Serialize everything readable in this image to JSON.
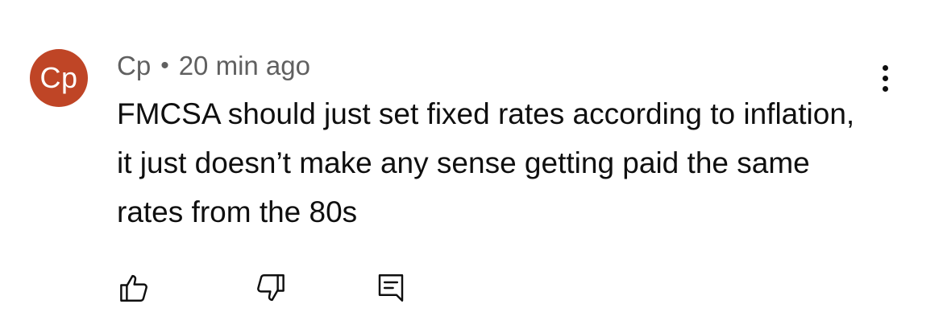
{
  "comment": {
    "avatar_initials": "Cp",
    "avatar_color": "#bf4526",
    "author": "Cp",
    "separator": "•",
    "timestamp": "20 min ago",
    "text": "FMCSA should just set fixed rates according to inflation, it just doesn’t make any sense getting paid the same rates from the 80s"
  },
  "actions": {
    "more_icon": "more-vertical-icon",
    "like_icon": "thumbs-up-icon",
    "dislike_icon": "thumbs-down-icon",
    "reply_icon": "reply-comment-icon"
  }
}
